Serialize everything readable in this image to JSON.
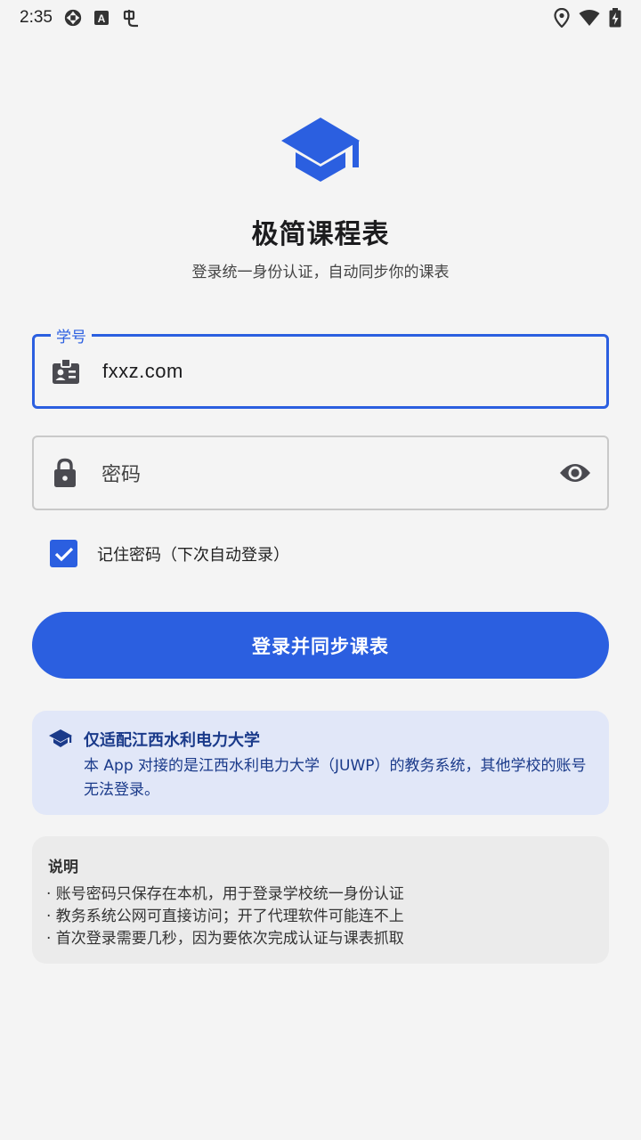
{
  "status_bar": {
    "time": "2:35",
    "icons_left": [
      "sync-icon",
      "a-box-icon",
      "bug-icon"
    ],
    "icons_right": [
      "location-icon",
      "wifi-icon",
      "battery-charging-icon"
    ]
  },
  "header": {
    "title": "极简课程表",
    "subtitle": "登录统一身份认证，自动同步你的课表",
    "logo_icon": "graduation-cap-icon"
  },
  "form": {
    "student_id": {
      "label": "学号",
      "value": "fxxz.com",
      "icon": "badge-icon"
    },
    "password": {
      "placeholder": "密码",
      "icon": "lock-icon",
      "toggle_icon": "eye-icon"
    },
    "remember": {
      "label": "记住密码（下次自动登录）",
      "checked": true
    },
    "submit_label": "登录并同步课表"
  },
  "notice": {
    "icon": "graduation-cap-icon",
    "title": "仅适配江西水利电力大学",
    "body": "本 App 对接的是江西水利电力大学（JUWP）的教务系统，其他学校的账号无法登录。"
  },
  "info": {
    "title": "说明",
    "items": [
      "· 账号密码只保存在本机，用于登录学校统一身份认证",
      "· 教务系统公网可直接访问；开了代理软件可能连不上",
      "· 首次登录需要几秒，因为要依次完成认证与课表抓取"
    ]
  },
  "colors": {
    "accent": "#2b5fe0",
    "notice_bg": "#e1e7f8",
    "notice_text": "#1a3a8a",
    "info_bg": "#ebebeb",
    "page_bg": "#f4f4f4"
  }
}
